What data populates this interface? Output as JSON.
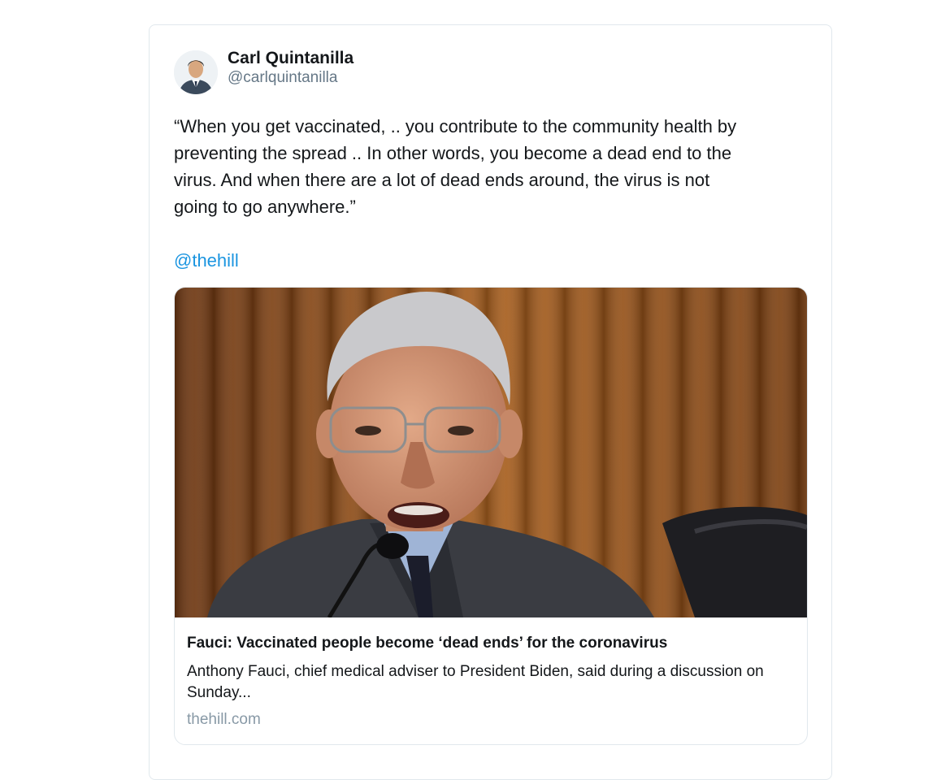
{
  "tweet": {
    "author": {
      "display_name": "Carl Quintanilla",
      "handle": "@carlquintanilla",
      "avatar_icon": "avatar-portrait-icon"
    },
    "text": "“When you get vaccinated, .. you contribute to the community health by\npreventing the spread .. In other words, you become a dead end to the\nvirus. And when there are a lot of dead ends around, the virus is not\ngoing to go anywhere.”",
    "mention": "@thehill"
  },
  "link_card": {
    "title": "Fauci: Vaccinated people become ‘dead ends’ for the coronavirus",
    "description": "Anthony Fauci, chief medical adviser to President Biden, said during a discussion on Sunday...",
    "domain": "thehill.com",
    "image_icon": "speaker-photo-icon"
  },
  "colors": {
    "link_blue": "#1b95e0",
    "border": "#e1e8ed",
    "muted": "#657786",
    "domain_gray": "#8899a6"
  }
}
